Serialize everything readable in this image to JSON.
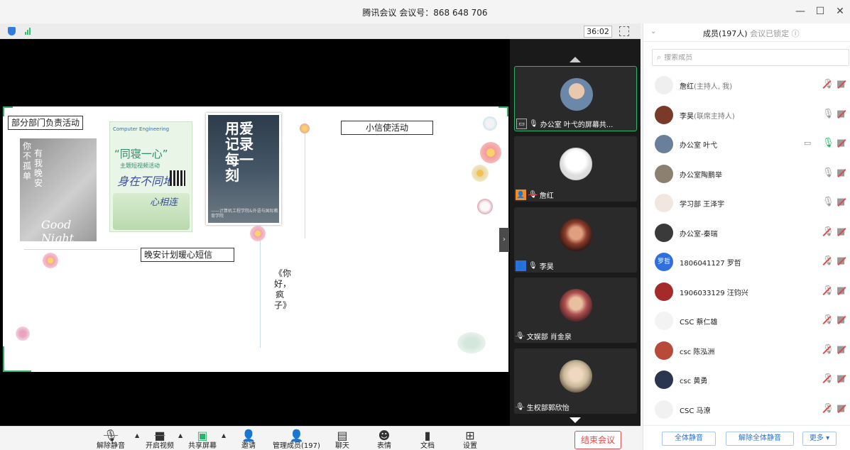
{
  "window": {
    "title": "腾讯会议 会议号：868 648 706",
    "minimize": "—",
    "maximize": "☐",
    "close": "✕"
  },
  "stage": {
    "timer": "36:02",
    "slide": {
      "label_department": "部分部门负责活动",
      "label_messenger": "小信使活动",
      "label_goodnight_plan": "晚安计划暖心短信",
      "photo_text_col1": "你不孤单",
      "photo_text_col2": "有我晚安",
      "photo_script": "Good Night",
      "poster2_header": "Computer Engineering",
      "poster2_title": "“同寝一心”",
      "poster2_subtitle": "主题短视频活动",
      "poster2_slogan": "身在不同地",
      "poster2_slogan2": "心相连",
      "poster3_title": "用爱记录每一刻",
      "poster3_footer": "——计算机工程学院&外语与国际教育学院",
      "vertical_title": "《你好，疯子》"
    }
  },
  "video_tiles": [
    {
      "name": "办公室 叶弋的屏幕共...",
      "badge": "screen",
      "mic": "on",
      "active": true,
      "avatar_color": "#6c88a8"
    },
    {
      "name": "詹红",
      "badge": "host",
      "mic": "muted",
      "active": false,
      "avatar_color": "#f2f2f2"
    },
    {
      "name": "李昊",
      "badge": "cohost",
      "mic": "on",
      "active": false,
      "avatar_color": "#8a3b2b"
    },
    {
      "name": "文娱部 肖金泉",
      "badge": "",
      "mic": "muted",
      "active": false,
      "avatar_color": "#b05050"
    },
    {
      "name": "生权部郭欣怡",
      "badge": "",
      "mic": "muted",
      "active": false,
      "avatar_color": "#c9b89a"
    }
  ],
  "toolbar": {
    "unmute": "解除静音",
    "start_video": "开启视频",
    "share_screen": "共享屏幕",
    "invite": "邀请",
    "manage_members": "管理成员(197)",
    "chat": "聊天",
    "emoji": "表情",
    "docs": "文档",
    "settings": "设置",
    "end_meeting": "结束会议"
  },
  "members_panel": {
    "title": "成员(197人)",
    "lock_status": "会议已锁定",
    "search_placeholder": "搜索成员",
    "members": [
      {
        "name": "詹红",
        "role": "(主持人, 我)",
        "mic": "muted",
        "share": false,
        "avatar_color": "#efefef",
        "avatar_text": ""
      },
      {
        "name": "李昊",
        "role": "(联席主持人)",
        "mic": "off",
        "share": false,
        "avatar_color": "#7a3a2a",
        "avatar_text": ""
      },
      {
        "name": "办公室 叶弋",
        "role": "",
        "mic": "on",
        "share": true,
        "avatar_color": "#6a7f9a",
        "avatar_text": ""
      },
      {
        "name": "办公室陶鹏举",
        "role": "",
        "mic": "off",
        "share": false,
        "avatar_color": "#8c8070",
        "avatar_text": ""
      },
      {
        "name": "学习部 王泽宇",
        "role": "",
        "mic": "off",
        "share": false,
        "avatar_color": "#f1e6e0",
        "avatar_text": ""
      },
      {
        "name": "办公室-秦瑞",
        "role": "",
        "mic": "muted",
        "share": false,
        "avatar_color": "#3a3a3a",
        "avatar_text": ""
      },
      {
        "name": "1806041127 罗哲",
        "role": "",
        "mic": "muted",
        "share": false,
        "avatar_color": "#2f6fe0",
        "avatar_text": "罗哲"
      },
      {
        "name": "1906033129 汪钧兴",
        "role": "",
        "mic": "muted",
        "share": false,
        "avatar_color": "#a52a2a",
        "avatar_text": ""
      },
      {
        "name": "CSC  蔡仁雄",
        "role": "",
        "mic": "muted",
        "share": false,
        "avatar_color": "#f3f3f3",
        "avatar_text": ""
      },
      {
        "name": "csc  陈泓洲",
        "role": "",
        "mic": "muted",
        "share": false,
        "avatar_color": "#b84a3a",
        "avatar_text": ""
      },
      {
        "name": "csc  黄勇",
        "role": "",
        "mic": "muted",
        "share": false,
        "avatar_color": "#2a3550",
        "avatar_text": ""
      },
      {
        "name": "CSC  马潦",
        "role": "",
        "mic": "muted",
        "share": false,
        "avatar_color": "#f1f1f1",
        "avatar_text": ""
      }
    ],
    "mute_all": "全体静音",
    "unmute_all": "解除全体静音",
    "more": "更多 ▾"
  },
  "colors": {
    "accent_green": "#2bb36a",
    "danger_red": "#e24b4b",
    "link_blue": "#2f6fc9"
  }
}
